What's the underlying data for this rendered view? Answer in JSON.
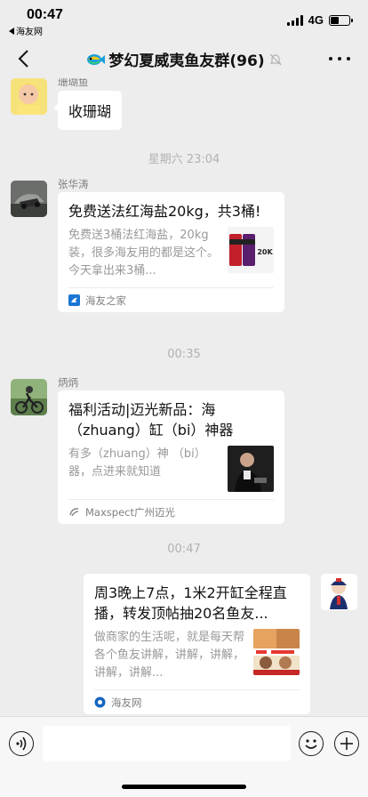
{
  "status_bar": {
    "time": "00:47",
    "back_app": "海友网",
    "network": "4G",
    "battery_level": 0.45
  },
  "nav": {
    "title": "梦幻夏威夷鱼友群(96)",
    "muted_icon": "bell-off-icon"
  },
  "chat": {
    "messages": [
      {
        "type": "text",
        "sender": "珊瑚鱼",
        "text": "收珊瑚"
      },
      {
        "type": "time",
        "text": "星期六 23:04"
      },
      {
        "type": "card",
        "sender": "张华涛",
        "title": "免费送法红海盐20kg，共3桶!",
        "desc": "免费送3桶法红海盐，20kg装，很多海友用的都是这个。今天拿出来3桶...",
        "thumb_label": "20K",
        "source": "海友之家"
      },
      {
        "type": "time",
        "text": "00:35"
      },
      {
        "type": "card",
        "sender": "炳炳",
        "title": "福利活动|迈光新品：海（zhuang）缸（bi）神器",
        "desc": "有多（zhuang）神 （bi）器，点进来就知道",
        "source": "Maxspect广州迈光"
      },
      {
        "type": "time",
        "text": "00:47"
      },
      {
        "type": "card",
        "sender": "",
        "title": "周3晚上7点，1米2开缸全程直播，转发顶帖抽20名鱼友...",
        "desc": "做商家的生活呢，就是每天帮各个鱼友讲解，讲解，讲解，讲解，讲解...",
        "source": "海友网"
      }
    ]
  },
  "input_bar": {
    "placeholder": ""
  },
  "colors": {
    "background": "#ededed",
    "bubble": "#ffffff",
    "meta_text": "#7f7f7f"
  }
}
